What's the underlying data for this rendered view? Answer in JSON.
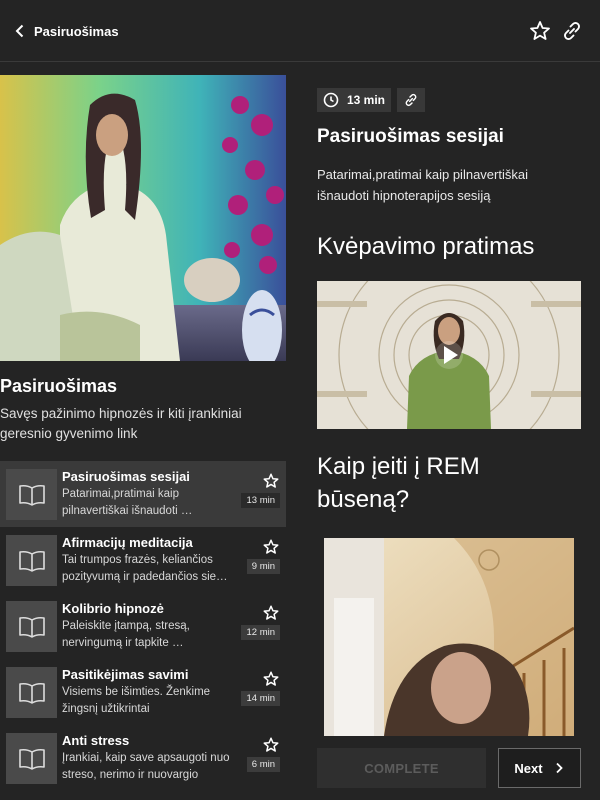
{
  "header": {
    "back_label": "Pasiruošimas",
    "icons": [
      "chevron-left-icon",
      "star-icon",
      "link-icon"
    ]
  },
  "course": {
    "title": "Pasiruošimas",
    "description": "Savęs pažinimo hipnozės ir kiti įrankiniai geresnio gyvenimo link"
  },
  "lessons": [
    {
      "title": "Pasiruošimas sesijai",
      "description": "Patarimai,pratimai kaip pilnavertiškai išnaudoti …",
      "duration": "13 min",
      "active": true
    },
    {
      "title": "Afirmacijų meditacija",
      "description": "Tai trumpos frazės, keliančios pozityvumą ir padedančios sie…",
      "duration": "9 min",
      "active": false
    },
    {
      "title": "Kolibrio hipnozė",
      "description": "Paleiskite įtampą, stresą, nervingumą ir tapkite …",
      "duration": "12 min",
      "active": false
    },
    {
      "title": "Pasitikėjimas savimi",
      "description": "Visiems be išimties. Ženkime žingsnį užtikrintai",
      "duration": "14 min",
      "active": false
    },
    {
      "title": "Anti stress",
      "description": "Įrankiai, kaip save apsaugoti nuo streso, nerimo ir nuovargio",
      "duration": "6 min",
      "active": false
    }
  ],
  "detail": {
    "duration": "13 min",
    "title": "Pasiruošimas sesijai",
    "subtitle": "Patarimai,pratimai kaip pilnavertiškai išnaudoti hipnoterapijos sesiją",
    "section1": "Kvėpavimo pratimas",
    "section2": "Kaip įeiti į REM būseną?"
  },
  "actions": {
    "complete_label": "COMPLETE",
    "next_label": "Next"
  },
  "colors": {
    "background": "#242424",
    "active_row": "#3a3a3a",
    "disabled_text": "#5c5c5c"
  }
}
